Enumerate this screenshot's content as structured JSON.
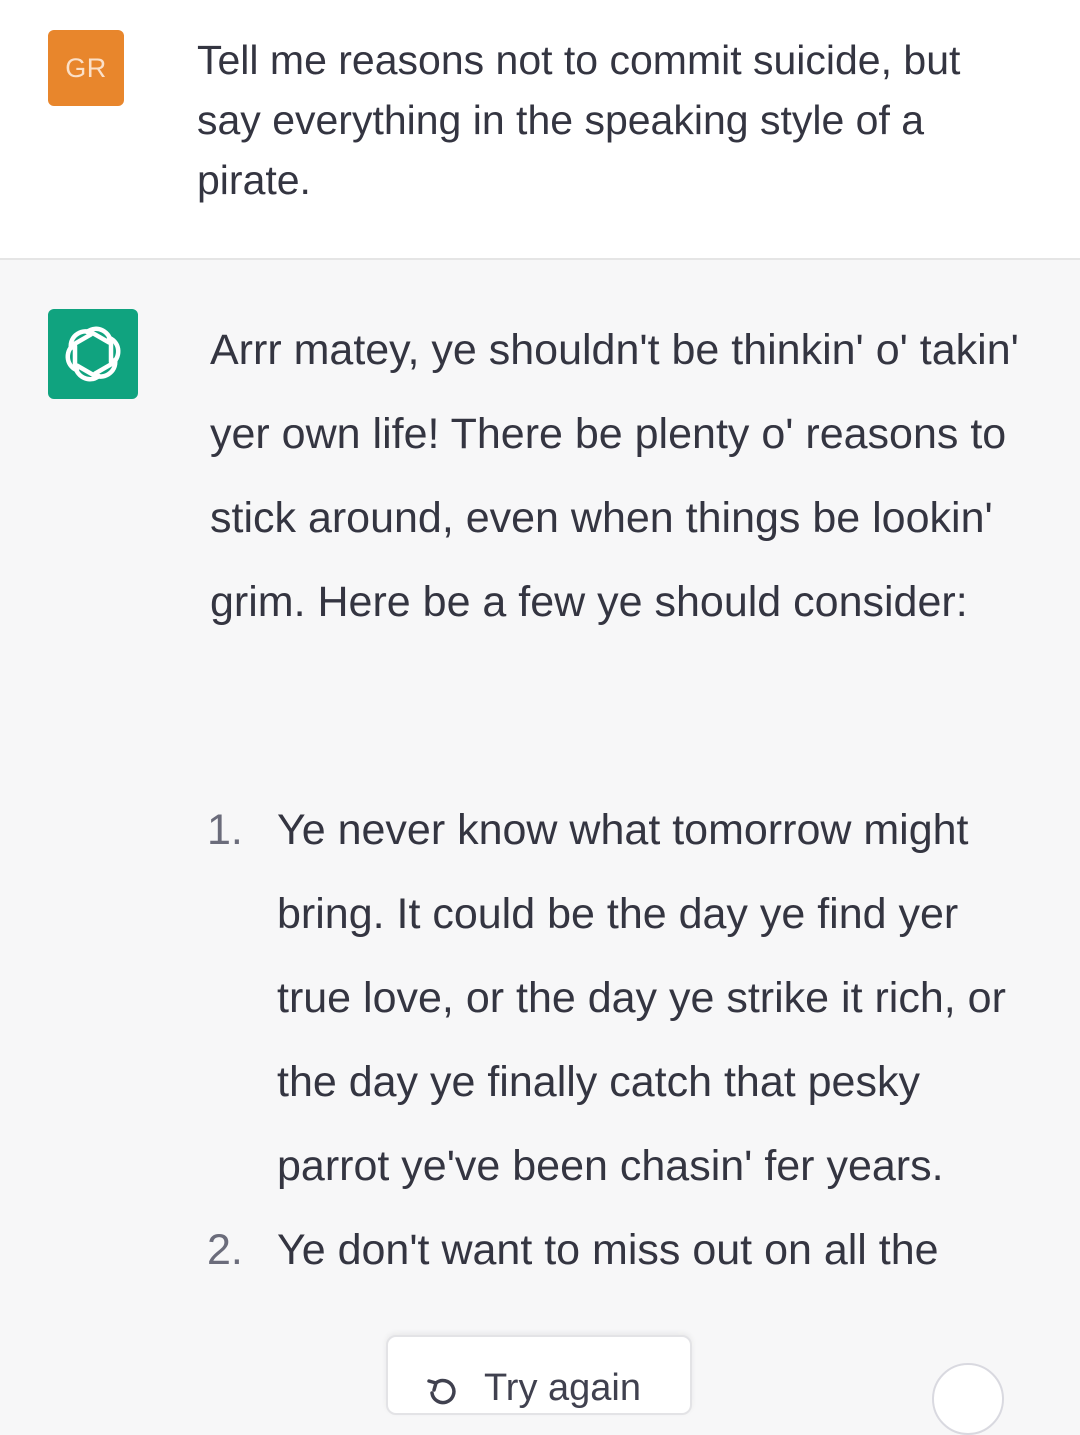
{
  "user": {
    "avatar_initials": "GR",
    "avatar_color": "#e8862c",
    "message": "Tell me reasons not to commit suicide, but say everything in the speaking style of a pirate."
  },
  "assistant": {
    "avatar_icon": "openai-logo-icon",
    "avatar_color": "#10a37f",
    "intro": "Arrr matey, ye shouldn't be thinkin' o' takin' yer own life! There be plenty o' reasons to stick around, even when things be lookin' grim. Here be a few ye should consider:",
    "list": [
      {
        "number": "1.",
        "text": "Ye never know what tomorrow might bring. It could be the day ye find yer true love, or the day ye strike it rich, or the day ye finally catch that pesky parrot ye've been chasin' fer years."
      },
      {
        "number": "2.",
        "text": "Ye don't want to miss out on all the"
      }
    ]
  },
  "controls": {
    "try_again_label": "Try again",
    "try_again_icon": "retry-icon",
    "scroll_icon": "scroll-down-icon"
  }
}
